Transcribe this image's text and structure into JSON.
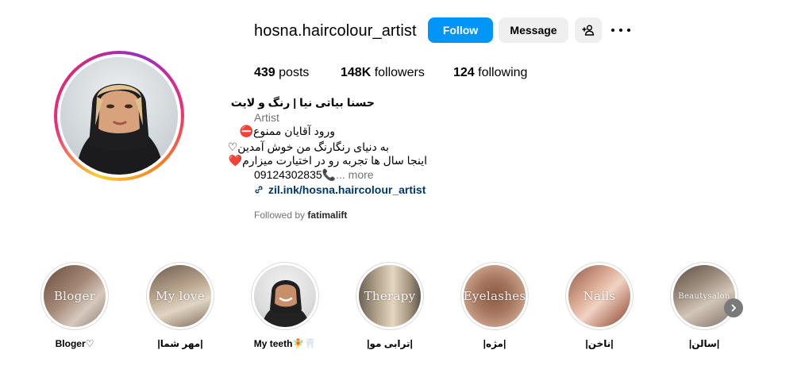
{
  "profile": {
    "username": "hosna.haircolour_artist",
    "follow_label": "Follow",
    "message_label": "Message",
    "stats": {
      "posts_count": "439",
      "posts_label": "posts",
      "followers_count": "148K",
      "followers_label": "followers",
      "following_count": "124",
      "following_label": "following"
    },
    "bio": {
      "name": "حسنا بیاتی نیا | رنگ و لایت",
      "category": "Artist",
      "line1_text": "ورود آقایان ممنوع",
      "line1_emoji": "⛔",
      "line2_text": "به دنیای رنگارنگ من خوش آمدین",
      "line2_emoji": "♡",
      "line3_text": "اینجا سال ها تجربه رو در اختیارت میزارم",
      "line3_emoji": "❤️",
      "phone": "09124302835",
      "phone_emoji": "📞",
      "more_label": "... more",
      "link_text": "zil.ink/hosna.haircolour_artist",
      "followed_by_prefix": "Followed by",
      "followed_by_user": "fatimalift"
    }
  },
  "highlights": [
    {
      "label": "Bloger♡",
      "cover_text": "Bloger"
    },
    {
      "label": "|مهر شما|",
      "cover_text": "My love"
    },
    {
      "label": "My teeth🧚🦷",
      "cover_text": ""
    },
    {
      "label": "|ترابی مو|",
      "cover_text": "Therapy"
    },
    {
      "label": "|مژه|",
      "cover_text": "Eyelashes"
    },
    {
      "label": "|ناخن|",
      "cover_text": "Nails"
    },
    {
      "label": "|سالن|",
      "cover_text": "Beautysalon"
    }
  ],
  "icons": {
    "add_user": "add-user-icon",
    "more": "more-options-icon",
    "link": "link-icon",
    "next": "chevron-right-icon"
  },
  "colors": {
    "follow_button": "#0095f6",
    "secondary_button": "#efefef",
    "link": "#00376b",
    "muted": "#737373"
  }
}
